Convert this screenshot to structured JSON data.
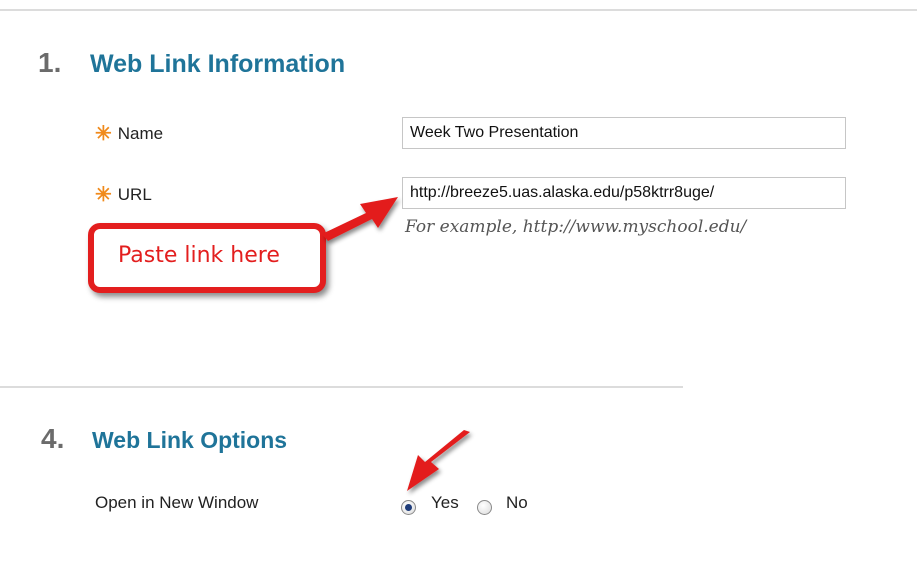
{
  "section1": {
    "number": "1.",
    "title": "Web Link Information",
    "fields": {
      "name": {
        "label": "Name",
        "value": "Week Two Presentation"
      },
      "url": {
        "label": "URL",
        "value": "http://breeze5.uas.alaska.edu/p58ktrr8uge/",
        "example": "For example, http://www.myschool.edu/"
      }
    },
    "required_glyph": "✳"
  },
  "callout": {
    "text": "Paste link here",
    "color": "#e31e1e"
  },
  "section4": {
    "number": "4.",
    "title": "Web Link Options",
    "open_new_window": {
      "label": "Open in New Window",
      "options": [
        {
          "label": "Yes",
          "selected": true
        },
        {
          "label": "No",
          "selected": false
        }
      ]
    }
  },
  "colors": {
    "heading": "#1f7499",
    "required": "#f08a1b",
    "annotation": "#e31e1e"
  }
}
